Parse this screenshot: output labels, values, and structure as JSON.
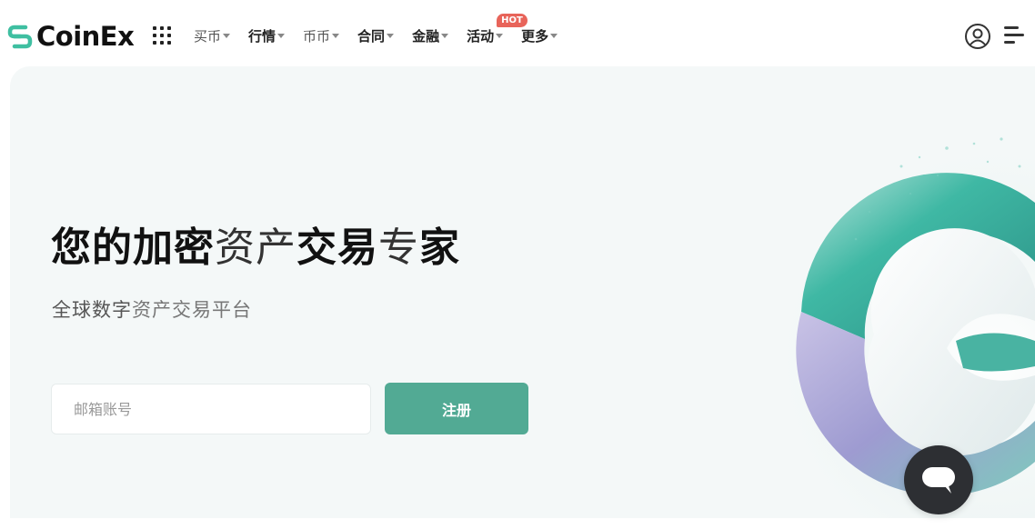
{
  "brand": {
    "name": "CoinEx",
    "accent": "#52aa94"
  },
  "nav": {
    "items": [
      {
        "label": "买币"
      },
      {
        "label": "行情"
      },
      {
        "label": "币币"
      },
      {
        "label": "合同"
      },
      {
        "label": "金融"
      },
      {
        "label": "活动",
        "badge": "HOT"
      },
      {
        "label": "更多"
      }
    ]
  },
  "hero": {
    "title_part1": "您的加密",
    "title_part2": "资产",
    "title_part3": "交易",
    "title_part4": "专",
    "title_part5": "家",
    "subtitle_part1": "全球数字",
    "subtitle_part2": "资产交易平台",
    "email_placeholder": "邮箱账号",
    "register_label": "注册"
  },
  "icons": {
    "apps": "grid-icon",
    "user": "user-icon",
    "menu": "menu-icon",
    "chat": "chat-icon"
  }
}
